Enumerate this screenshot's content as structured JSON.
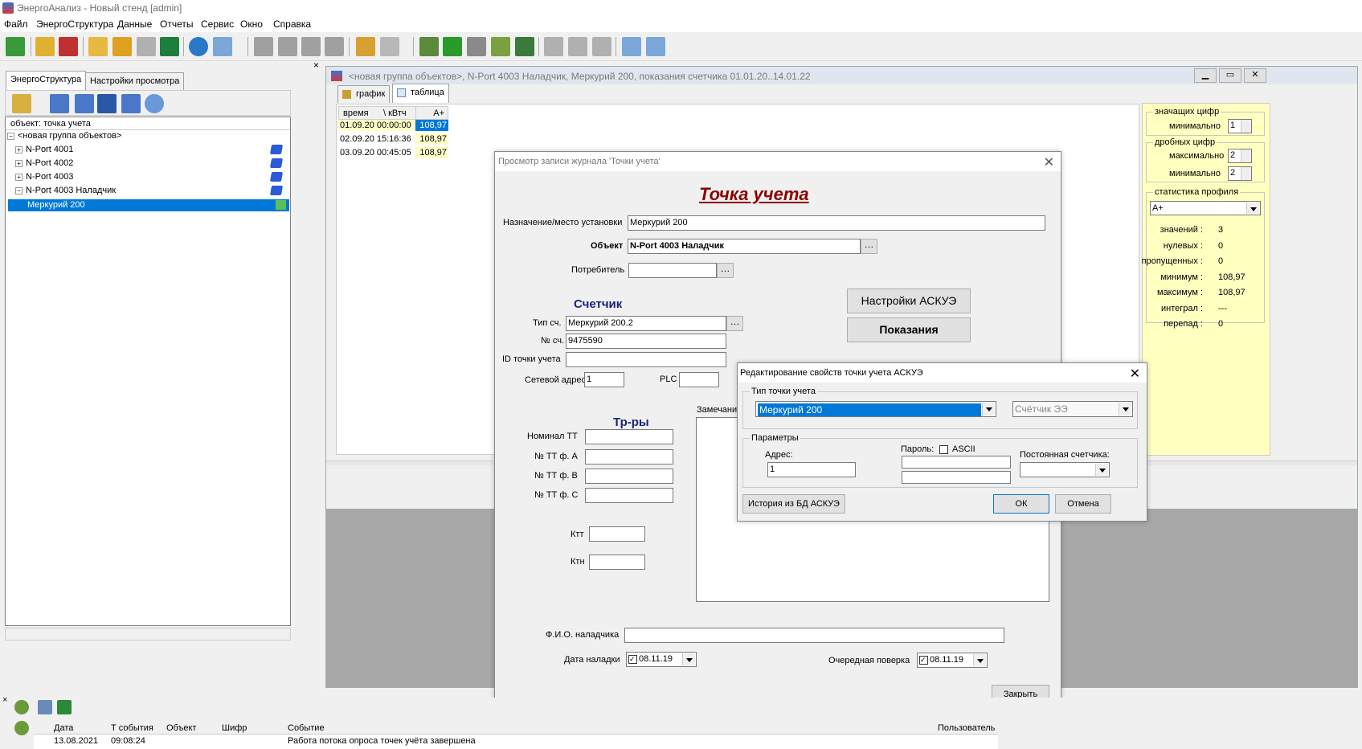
{
  "app": {
    "title": "ЭнергоАнализ - Новый стенд [admin]"
  },
  "menu": [
    "Файл",
    "ЭнергоСтруктура",
    "Данные",
    "Отчеты",
    "Сервис",
    "Окно",
    "Справка"
  ],
  "leftTabs": [
    "ЭнергоСтруктура",
    "Настройки просмотра"
  ],
  "tree": {
    "header": "объект: точка учета",
    "root": "<новая группа объектов>",
    "items": [
      "N-Port 4001",
      "N-Port 4002",
      "N-Port 4003",
      "N-Port 4003 Наладчик"
    ],
    "selected": "Меркурий 200"
  },
  "mdi": {
    "title": "<новая группа объектов>, N-Port 4003 Наладчик, Меркурий 200, показания счетчика 01.01.20..14.01.22",
    "tabs": [
      "график",
      "таблица"
    ]
  },
  "grid": {
    "headers": [
      "время",
      "\\ кВтч",
      "A+"
    ],
    "rows": [
      [
        "01.09.20 00:00:00",
        "108,97"
      ],
      [
        "02.09.20 15:16:36",
        "108,97"
      ],
      [
        "03.09.20 00:45:05",
        "108,97"
      ]
    ]
  },
  "stats": {
    "sig_title": "значащих цифр",
    "min_label": "минимально",
    "sig_min": "1",
    "frac_title": "дробных цифр",
    "max_label": "максимально",
    "frac_max": "2",
    "frac_min": "2",
    "prof_title": "статистика профиля",
    "prof_select": "A+",
    "rows": [
      [
        "значений :",
        "3"
      ],
      [
        "нулевых :",
        "0"
      ],
      [
        "пропущенных :",
        "0"
      ],
      [
        "минимум :",
        "108,97"
      ],
      [
        "максимум :",
        "108,97"
      ],
      [
        "интеграл :",
        "---"
      ],
      [
        "перепад :",
        "0"
      ]
    ]
  },
  "journal": {
    "title": "Просмотр записи журнала 'Точки учета'",
    "heading": "Точка учета",
    "dest_label": "Назначение/место установки",
    "dest_value": "Меркурий 200",
    "obj_label": "Объект",
    "obj_value": "N-Port 4003 Наладчик",
    "consumer_label": "Потребитель",
    "btn_askue": "Настройки АСКУЭ",
    "btn_readings": "Показания",
    "meter_section": "Счетчик",
    "type_label": "Тип сч.",
    "type_value": "Меркурий 200.2",
    "num_label": "№ сч.",
    "num_value": "9475590",
    "id_label": "ID точки учета",
    "net_label": "Сетевой адрес",
    "net_value": "1",
    "plc_label": "PLC",
    "tr_section": "Тр-ры",
    "notes_label": "Замечани",
    "tt_labels": [
      "Номинал ТТ",
      "№ ТТ ф. А",
      "№ ТТ ф. В",
      "№ ТТ ф. С"
    ],
    "ktt": "Ктт",
    "ktn": "Ктн",
    "fio_label": "Ф.И.О. наладчика",
    "date_label": "Дата наладки",
    "date_value": "08.11.19",
    "check_label": "Очередная поверка",
    "check_value": "08.11.19",
    "close": "Закрыть"
  },
  "askue": {
    "title": "Редактирование свойств точки учета АСКУЭ",
    "type_group": "Тип точки учета",
    "type_value": "Меркурий 200",
    "type2_value": "Счётчик ЭЭ",
    "params_group": "Параметры",
    "addr_label": "Адрес:",
    "addr_value": "1",
    "pass_label": "Пароль:",
    "ascii": "ASCII",
    "const_label": "Постоянная счетчика:",
    "history": "История из БД АСКУЭ",
    "ok": "ОК",
    "cancel": "Отмена"
  },
  "log": {
    "headers": [
      "Дата",
      "Т события",
      "Объект",
      "Шифр",
      "Событие",
      "Пользователь"
    ],
    "row": [
      "13.08.2021",
      "09:08:24",
      "",
      "",
      "Работа потока опроса точек учёта завершена",
      ""
    ]
  }
}
